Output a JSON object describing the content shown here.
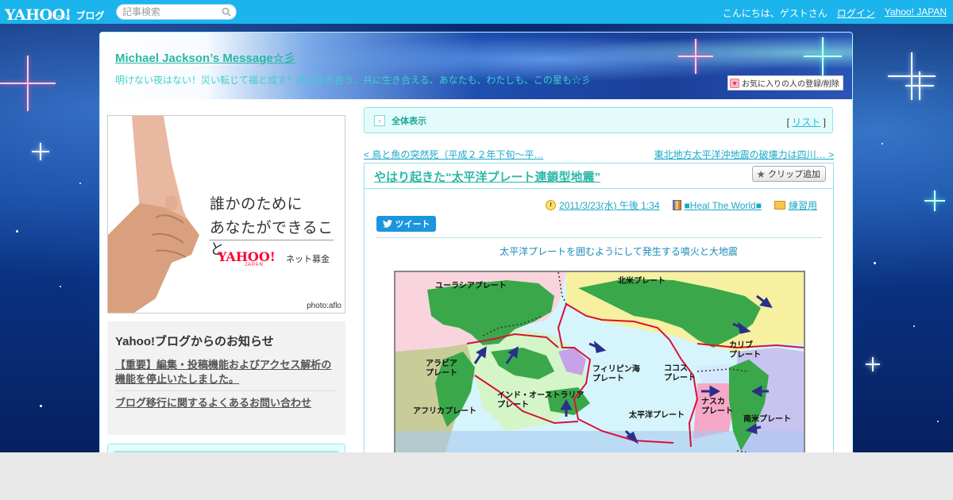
{
  "topbar": {
    "logo_text": "YAHOO!",
    "logo_sub": "JAPAN",
    "blog_label": "ブログ",
    "search_placeholder": "記事検索",
    "greeting": "こんにちは、ゲストさん",
    "login": "ログイン",
    "yahoo_japan": "Yahoo! JAPAN"
  },
  "header": {
    "blog_title": "Michael Jackson’s Message☆彡",
    "description": "明けない夜はない！災い転じて福と成す！共に生き合う、共に生き合える、あなたも、わたしも、この星も☆彡",
    "fav_button": "お気に入りの人の登録/削除"
  },
  "ad": {
    "line1": "誰かのために",
    "line2": "あなたができること",
    "brand": "YAHOO!",
    "brand_sub": "JAPAN",
    "service": "ネット募金",
    "credit": "photo:aflo"
  },
  "notice": {
    "heading": "Yahoo!ブログからのお知らせ",
    "items": [
      "【重要】編集・投稿機能およびアクセス解析の機能を停止いたしました。",
      "ブログ移行に関するよくあるお問い合わせ"
    ]
  },
  "main": {
    "allview_label": "全体表示",
    "list_bracket_open": "[",
    "list_label": "リスト",
    "list_bracket_close": "]",
    "prev_link": "< 鳥と魚の突然死（平成２２年下旬～平…",
    "next_link": "東北地方太平洋沖地震の破壊力は四川… >",
    "article": {
      "title": "やはり起きた“太平洋プレート連鎖型地震”",
      "clip_button": "クリップ追加",
      "date": "2011/3/23(水) 午後 1:34",
      "category": "■Heal The World■",
      "folder": "練習用",
      "tweet": "ツイート",
      "caption": "太平洋プレートを囲むようにして発生する噴火と大地震"
    },
    "map_labels": {
      "eurasia": "ユーラシアプレート",
      "north_america": "北米プレート",
      "arabia": "アラビア\nプレート",
      "philippine": "フィリピン海\nプレート",
      "cocos": "ココス\nプレート",
      "caribbean": "カリブ\nプレート",
      "india_australia": "インド・オーストラリア\nプレート",
      "africa": "アフリカプレート",
      "pacific": "太平洋プレート",
      "nazca": "ナスカ\nプレート",
      "south_america": "南米プレート"
    }
  },
  "colors": {
    "topbar": "#1cb4ec",
    "accent_teal": "#2ab8a6",
    "link_blue": "#1aa8c8",
    "ocean": "#6fcaf0",
    "land": "#3aa84a",
    "plate_boundary": "#d8103a"
  }
}
